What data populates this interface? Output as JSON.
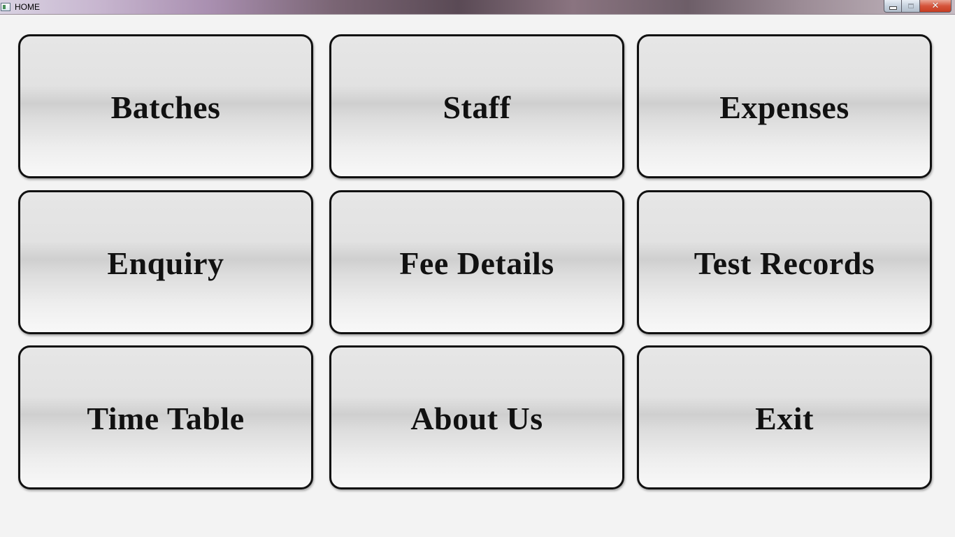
{
  "window": {
    "title": "HOME",
    "controls": {
      "minimize_icon": "minimize-icon",
      "maximize_icon": "maximize-icon",
      "close_icon": "close-icon",
      "close_color": "#c73d22"
    }
  },
  "menu": {
    "tiles": [
      {
        "label": "Batches"
      },
      {
        "label": "Staff"
      },
      {
        "label": "Expenses"
      },
      {
        "label": "Enquiry"
      },
      {
        "label": "Fee Details"
      },
      {
        "label": "Test Records"
      },
      {
        "label": "Time Table"
      },
      {
        "label": "About Us"
      },
      {
        "label": "Exit"
      }
    ]
  },
  "colors": {
    "background": "#f3f3f3",
    "tile_border": "#111111",
    "tile_text": "#111111"
  }
}
